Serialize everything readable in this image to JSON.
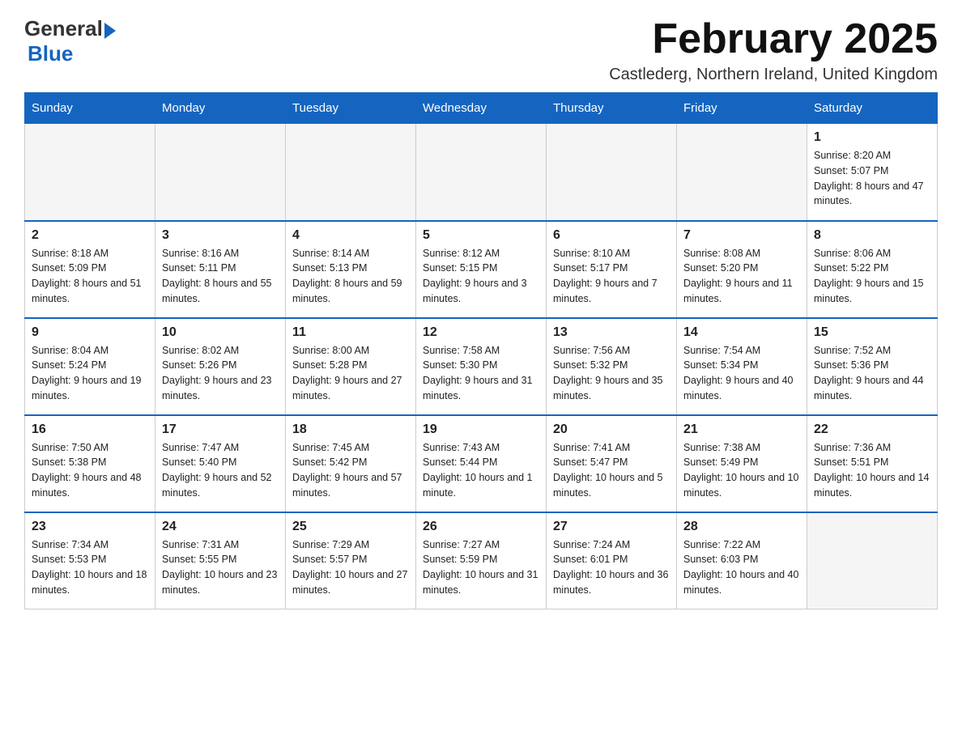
{
  "logo": {
    "general": "General",
    "blue": "Blue"
  },
  "header": {
    "month_year": "February 2025",
    "location": "Castlederg, Northern Ireland, United Kingdom"
  },
  "weekdays": [
    "Sunday",
    "Monday",
    "Tuesday",
    "Wednesday",
    "Thursday",
    "Friday",
    "Saturday"
  ],
  "weeks": [
    [
      {
        "day": "",
        "sunrise": "",
        "sunset": "",
        "daylight": ""
      },
      {
        "day": "",
        "sunrise": "",
        "sunset": "",
        "daylight": ""
      },
      {
        "day": "",
        "sunrise": "",
        "sunset": "",
        "daylight": ""
      },
      {
        "day": "",
        "sunrise": "",
        "sunset": "",
        "daylight": ""
      },
      {
        "day": "",
        "sunrise": "",
        "sunset": "",
        "daylight": ""
      },
      {
        "day": "",
        "sunrise": "",
        "sunset": "",
        "daylight": ""
      },
      {
        "day": "1",
        "sunrise": "Sunrise: 8:20 AM",
        "sunset": "Sunset: 5:07 PM",
        "daylight": "Daylight: 8 hours and 47 minutes."
      }
    ],
    [
      {
        "day": "2",
        "sunrise": "Sunrise: 8:18 AM",
        "sunset": "Sunset: 5:09 PM",
        "daylight": "Daylight: 8 hours and 51 minutes."
      },
      {
        "day": "3",
        "sunrise": "Sunrise: 8:16 AM",
        "sunset": "Sunset: 5:11 PM",
        "daylight": "Daylight: 8 hours and 55 minutes."
      },
      {
        "day": "4",
        "sunrise": "Sunrise: 8:14 AM",
        "sunset": "Sunset: 5:13 PM",
        "daylight": "Daylight: 8 hours and 59 minutes."
      },
      {
        "day": "5",
        "sunrise": "Sunrise: 8:12 AM",
        "sunset": "Sunset: 5:15 PM",
        "daylight": "Daylight: 9 hours and 3 minutes."
      },
      {
        "day": "6",
        "sunrise": "Sunrise: 8:10 AM",
        "sunset": "Sunset: 5:17 PM",
        "daylight": "Daylight: 9 hours and 7 minutes."
      },
      {
        "day": "7",
        "sunrise": "Sunrise: 8:08 AM",
        "sunset": "Sunset: 5:20 PM",
        "daylight": "Daylight: 9 hours and 11 minutes."
      },
      {
        "day": "8",
        "sunrise": "Sunrise: 8:06 AM",
        "sunset": "Sunset: 5:22 PM",
        "daylight": "Daylight: 9 hours and 15 minutes."
      }
    ],
    [
      {
        "day": "9",
        "sunrise": "Sunrise: 8:04 AM",
        "sunset": "Sunset: 5:24 PM",
        "daylight": "Daylight: 9 hours and 19 minutes."
      },
      {
        "day": "10",
        "sunrise": "Sunrise: 8:02 AM",
        "sunset": "Sunset: 5:26 PM",
        "daylight": "Daylight: 9 hours and 23 minutes."
      },
      {
        "day": "11",
        "sunrise": "Sunrise: 8:00 AM",
        "sunset": "Sunset: 5:28 PM",
        "daylight": "Daylight: 9 hours and 27 minutes."
      },
      {
        "day": "12",
        "sunrise": "Sunrise: 7:58 AM",
        "sunset": "Sunset: 5:30 PM",
        "daylight": "Daylight: 9 hours and 31 minutes."
      },
      {
        "day": "13",
        "sunrise": "Sunrise: 7:56 AM",
        "sunset": "Sunset: 5:32 PM",
        "daylight": "Daylight: 9 hours and 35 minutes."
      },
      {
        "day": "14",
        "sunrise": "Sunrise: 7:54 AM",
        "sunset": "Sunset: 5:34 PM",
        "daylight": "Daylight: 9 hours and 40 minutes."
      },
      {
        "day": "15",
        "sunrise": "Sunrise: 7:52 AM",
        "sunset": "Sunset: 5:36 PM",
        "daylight": "Daylight: 9 hours and 44 minutes."
      }
    ],
    [
      {
        "day": "16",
        "sunrise": "Sunrise: 7:50 AM",
        "sunset": "Sunset: 5:38 PM",
        "daylight": "Daylight: 9 hours and 48 minutes."
      },
      {
        "day": "17",
        "sunrise": "Sunrise: 7:47 AM",
        "sunset": "Sunset: 5:40 PM",
        "daylight": "Daylight: 9 hours and 52 minutes."
      },
      {
        "day": "18",
        "sunrise": "Sunrise: 7:45 AM",
        "sunset": "Sunset: 5:42 PM",
        "daylight": "Daylight: 9 hours and 57 minutes."
      },
      {
        "day": "19",
        "sunrise": "Sunrise: 7:43 AM",
        "sunset": "Sunset: 5:44 PM",
        "daylight": "Daylight: 10 hours and 1 minute."
      },
      {
        "day": "20",
        "sunrise": "Sunrise: 7:41 AM",
        "sunset": "Sunset: 5:47 PM",
        "daylight": "Daylight: 10 hours and 5 minutes."
      },
      {
        "day": "21",
        "sunrise": "Sunrise: 7:38 AM",
        "sunset": "Sunset: 5:49 PM",
        "daylight": "Daylight: 10 hours and 10 minutes."
      },
      {
        "day": "22",
        "sunrise": "Sunrise: 7:36 AM",
        "sunset": "Sunset: 5:51 PM",
        "daylight": "Daylight: 10 hours and 14 minutes."
      }
    ],
    [
      {
        "day": "23",
        "sunrise": "Sunrise: 7:34 AM",
        "sunset": "Sunset: 5:53 PM",
        "daylight": "Daylight: 10 hours and 18 minutes."
      },
      {
        "day": "24",
        "sunrise": "Sunrise: 7:31 AM",
        "sunset": "Sunset: 5:55 PM",
        "daylight": "Daylight: 10 hours and 23 minutes."
      },
      {
        "day": "25",
        "sunrise": "Sunrise: 7:29 AM",
        "sunset": "Sunset: 5:57 PM",
        "daylight": "Daylight: 10 hours and 27 minutes."
      },
      {
        "day": "26",
        "sunrise": "Sunrise: 7:27 AM",
        "sunset": "Sunset: 5:59 PM",
        "daylight": "Daylight: 10 hours and 31 minutes."
      },
      {
        "day": "27",
        "sunrise": "Sunrise: 7:24 AM",
        "sunset": "Sunset: 6:01 PM",
        "daylight": "Daylight: 10 hours and 36 minutes."
      },
      {
        "day": "28",
        "sunrise": "Sunrise: 7:22 AM",
        "sunset": "Sunset: 6:03 PM",
        "daylight": "Daylight: 10 hours and 40 minutes."
      },
      {
        "day": "",
        "sunrise": "",
        "sunset": "",
        "daylight": ""
      }
    ]
  ]
}
